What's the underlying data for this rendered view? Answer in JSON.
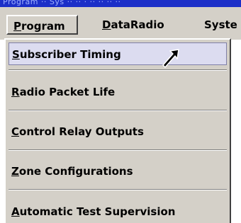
{
  "window": {
    "title_fragment": "Program  ·· Sys ·· ·· · ·· ·· ·· ··"
  },
  "menubar": {
    "items": [
      {
        "mnemonic": "P",
        "rest": "rogram"
      },
      {
        "mnemonic": "D",
        "rest": "ataRadio"
      },
      {
        "label": "Syste"
      }
    ]
  },
  "dropdown": {
    "items": [
      {
        "mnemonic": "S",
        "rest": "ubscriber Timing"
      },
      {
        "mnemonic": "R",
        "rest": "adio Packet Life"
      },
      {
        "mnemonic": "C",
        "rest": "ontrol Relay Outputs"
      },
      {
        "mnemonic": "Z",
        "rest": "one Configurations"
      },
      {
        "mnemonic": "A",
        "rest": "utomatic Test Supervision"
      }
    ]
  },
  "cursor": {
    "icon": "arrow-pointer-icon"
  }
}
